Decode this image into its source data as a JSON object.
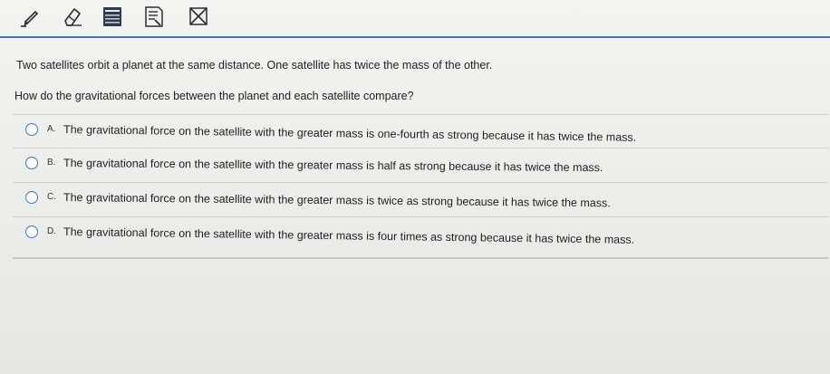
{
  "toolbar": {
    "tools": [
      {
        "icon": "pencil-icon"
      },
      {
        "icon": "eraser-icon"
      },
      {
        "icon": "calculator-icon"
      },
      {
        "icon": "reference-sheet-icon"
      },
      {
        "icon": "answer-eliminator-icon"
      }
    ],
    "accent_color": "#4a77a8"
  },
  "question": {
    "stem": "Two satellites orbit a planet at the same distance. One satellite has twice the mass of the other.",
    "prompt": "How do the gravitational forces between the planet and each satellite compare?"
  },
  "answers": [
    {
      "letter": "A.",
      "text": "The gravitational force on the satellite with the greater mass is one-fourth as strong because it has twice the mass."
    },
    {
      "letter": "B.",
      "text": "The gravitational force on the satellite with the greater mass is half as strong because it has twice the mass."
    },
    {
      "letter": "C.",
      "text": "The gravitational force on the satellite with the greater mass is twice as strong because it has twice the mass."
    },
    {
      "letter": "D.",
      "text": "The gravitational force on the satellite with the greater mass is four times as strong because it has twice the mass."
    }
  ]
}
